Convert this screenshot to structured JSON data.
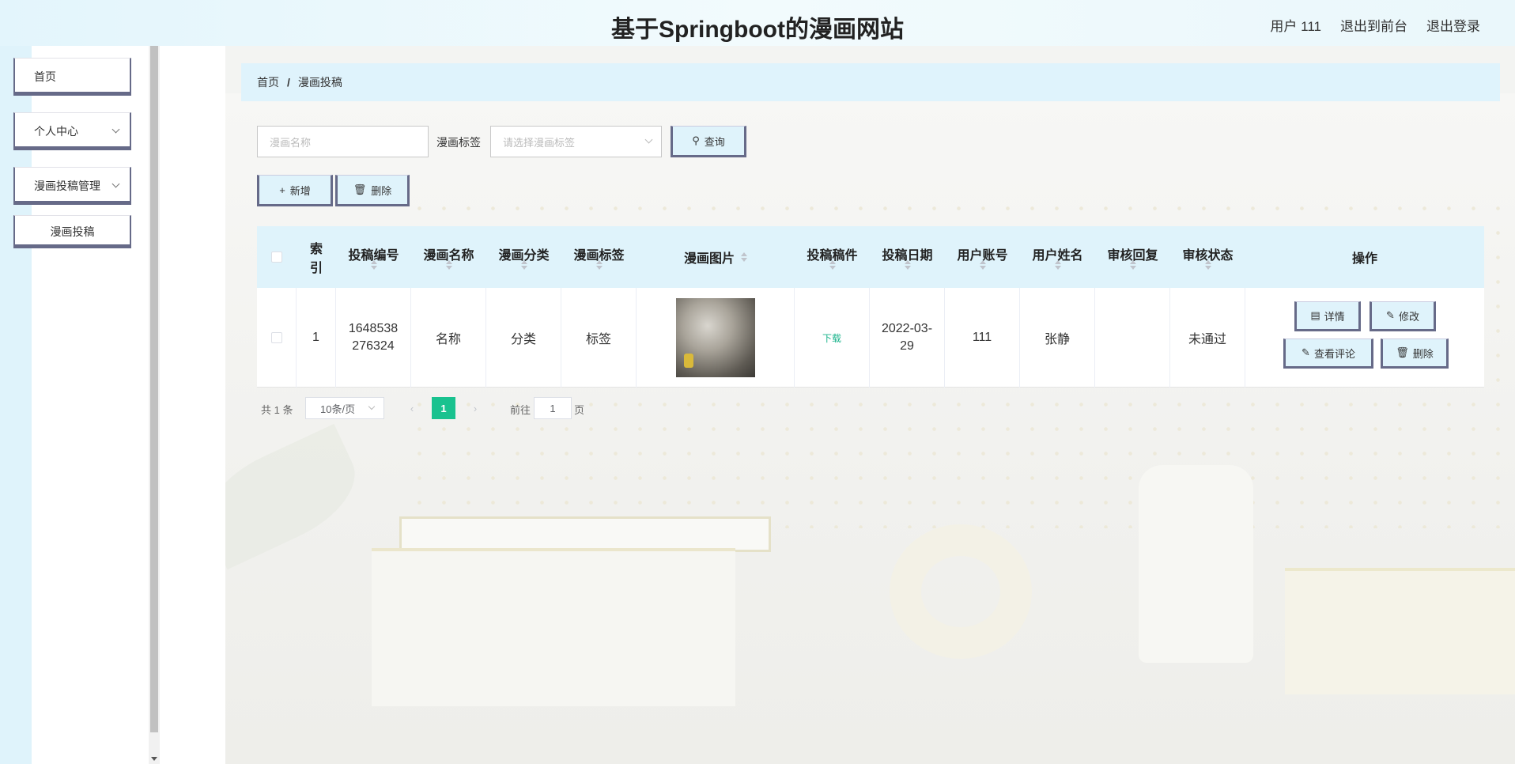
{
  "header": {
    "title": "基于Springboot的漫画网站",
    "user_label": "用户 111",
    "to_front": "退出到前台",
    "logout": "退出登录"
  },
  "sidebar": {
    "items": [
      {
        "label": "首页"
      },
      {
        "label": "个人中心"
      },
      {
        "label": "漫画投稿管理"
      },
      {
        "label": "漫画投稿"
      }
    ]
  },
  "breadcrumb": {
    "home": "首页",
    "sep": "/",
    "current": "漫画投稿"
  },
  "search": {
    "name_placeholder": "漫画名称",
    "tag_label": "漫画标签",
    "tag_placeholder": "请选择漫画标签",
    "query_label": "查询"
  },
  "toolbar": {
    "add_label": "新增",
    "delete_label": "删除"
  },
  "table": {
    "headers": [
      "索引",
      "投稿编号",
      "漫画名称",
      "漫画分类",
      "漫画标签",
      "漫画图片",
      "投稿稿件",
      "投稿日期",
      "用户账号",
      "用户姓名",
      "审核回复",
      "审核状态",
      "操作"
    ],
    "index_header_line1": "索",
    "index_header_line2": "引",
    "rows": [
      {
        "index": "1",
        "id_line1": "1648538",
        "id_line2": "276324",
        "name": "名称",
        "category": "分类",
        "tag": "标签",
        "file_link": "下载",
        "date_line1": "2022-03-",
        "date_line2": "29",
        "account": "111",
        "user_name": "张静",
        "reply": "",
        "status": "未通过"
      }
    ],
    "actions": {
      "detail": "详情",
      "edit": "修改",
      "comments": "查看评论",
      "delete": "删除"
    }
  },
  "pagination": {
    "total": "共 1 条",
    "page_size": "10条/页",
    "current_page": "1",
    "goto_label": "前往",
    "goto_value": "1",
    "page_unit": "页"
  },
  "colors": {
    "header_bg": "#e3f5fc",
    "accent_border": "#666a88",
    "button_bg": "#dff3fb",
    "pager_active": "#19c28f",
    "link": "#19b38b"
  }
}
